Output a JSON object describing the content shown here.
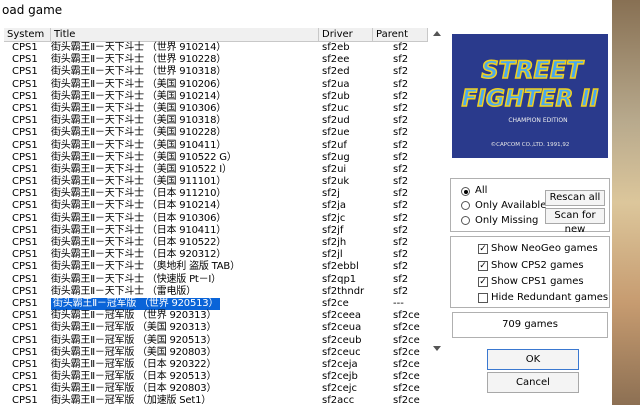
{
  "window": {
    "title": "oad game"
  },
  "list": {
    "columns": {
      "system": "System",
      "title": "Title",
      "driver": "Driver",
      "parent": "Parent"
    },
    "rows": [
      {
        "system": "CPS1",
        "title": "街头霸王Ⅱ－天下斗士 （世界 910214）",
        "driver": "sf2eb",
        "parent": "sf2"
      },
      {
        "system": "CPS1",
        "title": "街头霸王Ⅱ－天下斗士 （世界 910228）",
        "driver": "sf2ee",
        "parent": "sf2"
      },
      {
        "system": "CPS1",
        "title": "街头霸王Ⅱ－天下斗士 （世界 910318）",
        "driver": "sf2ed",
        "parent": "sf2"
      },
      {
        "system": "CPS1",
        "title": "街头霸王Ⅱ－天下斗士 （美国 910206）",
        "driver": "sf2ua",
        "parent": "sf2"
      },
      {
        "system": "CPS1",
        "title": "街头霸王Ⅱ－天下斗士 （美国 910214）",
        "driver": "sf2ub",
        "parent": "sf2"
      },
      {
        "system": "CPS1",
        "title": "街头霸王Ⅱ－天下斗士 （美国 910306）",
        "driver": "sf2uc",
        "parent": "sf2"
      },
      {
        "system": "CPS1",
        "title": "街头霸王Ⅱ－天下斗士 （美国 910318）",
        "driver": "sf2ud",
        "parent": "sf2"
      },
      {
        "system": "CPS1",
        "title": "街头霸王Ⅱ－天下斗士 （美国 910228）",
        "driver": "sf2ue",
        "parent": "sf2"
      },
      {
        "system": "CPS1",
        "title": "街头霸王Ⅱ－天下斗士 （美国 910411）",
        "driver": "sf2uf",
        "parent": "sf2"
      },
      {
        "system": "CPS1",
        "title": "街头霸王Ⅱ－天下斗士 （美国 910522 G）",
        "driver": "sf2ug",
        "parent": "sf2"
      },
      {
        "system": "CPS1",
        "title": "街头霸王Ⅱ－天下斗士 （美国 910522 I）",
        "driver": "sf2ui",
        "parent": "sf2"
      },
      {
        "system": "CPS1",
        "title": "街头霸王Ⅱ－天下斗士 （美国 911101）",
        "driver": "sf2uk",
        "parent": "sf2"
      },
      {
        "system": "CPS1",
        "title": "街头霸王Ⅱ－天下斗士 （日本 911210）",
        "driver": "sf2j",
        "parent": "sf2"
      },
      {
        "system": "CPS1",
        "title": "街头霸王Ⅱ－天下斗士 （日本 910214）",
        "driver": "sf2ja",
        "parent": "sf2"
      },
      {
        "system": "CPS1",
        "title": "街头霸王Ⅱ－天下斗士 （日本 910306）",
        "driver": "sf2jc",
        "parent": "sf2"
      },
      {
        "system": "CPS1",
        "title": "街头霸王Ⅱ－天下斗士 （日本 910411）",
        "driver": "sf2jf",
        "parent": "sf2"
      },
      {
        "system": "CPS1",
        "title": "街头霸王Ⅱ－天下斗士 （日本 910522）",
        "driver": "sf2jh",
        "parent": "sf2"
      },
      {
        "system": "CPS1",
        "title": "街头霸王Ⅱ－天下斗士 （日本 920312）",
        "driver": "sf2jl",
        "parent": "sf2"
      },
      {
        "system": "CPS1",
        "title": "街头霸王Ⅱ－天下斗士 （奥地利 盗版 TAB）",
        "driver": "sf2ebbl",
        "parent": "sf2"
      },
      {
        "system": "CPS1",
        "title": "街头霸王Ⅱ－天下斗士 （快速版 Pt－I）",
        "driver": "sf2qp1",
        "parent": "sf2"
      },
      {
        "system": "CPS1",
        "title": "街头霸王Ⅱ－天下斗士 （雷电版）",
        "driver": "sf2thndr",
        "parent": "sf2"
      },
      {
        "system": "CPS1",
        "title": "街头霸王Ⅱ－冠军版 （世界 920513）",
        "driver": "sf2ce",
        "parent": "---",
        "selected": true
      },
      {
        "system": "CPS1",
        "title": "街头霸王Ⅱ－冠军版 （世界 920313）",
        "driver": "sf2ceea",
        "parent": "sf2ce"
      },
      {
        "system": "CPS1",
        "title": "街头霸王Ⅱ－冠军版 （美国 920313）",
        "driver": "sf2ceua",
        "parent": "sf2ce"
      },
      {
        "system": "CPS1",
        "title": "街头霸王Ⅱ－冠军版 （美国 920513）",
        "driver": "sf2ceub",
        "parent": "sf2ce"
      },
      {
        "system": "CPS1",
        "title": "街头霸王Ⅱ－冠军版 （美国 920803）",
        "driver": "sf2ceuc",
        "parent": "sf2ce"
      },
      {
        "system": "CPS1",
        "title": "街头霸王Ⅱ－冠军版 （日本 920322）",
        "driver": "sf2ceja",
        "parent": "sf2ce"
      },
      {
        "system": "CPS1",
        "title": "街头霸王Ⅱ－冠军版 （日本 920513）",
        "driver": "sf2cejb",
        "parent": "sf2ce"
      },
      {
        "system": "CPS1",
        "title": "街头霸王Ⅱ－冠军版 （日本 920803）",
        "driver": "sf2cejc",
        "parent": "sf2ce"
      },
      {
        "system": "CPS1",
        "title": "街头霸王Ⅱ－冠军版 （加速版 Set1）",
        "driver": "sf2acc",
        "parent": "sf2ce"
      }
    ]
  },
  "preview": {
    "logo_top": "STREET",
    "logo_bottom": "FIGHTER II",
    "edition": "CHAMPION EDITION",
    "copyright": "©CAPCOM CO.,LTD. 1991,92"
  },
  "filter": {
    "all_label": "All",
    "available_label": "Only Available",
    "missing_label": "Only Missing",
    "selected": "all"
  },
  "buttons": {
    "rescan": "Rescan all",
    "scan_new": "Scan for new",
    "ok": "OK",
    "cancel": "Cancel"
  },
  "options": {
    "neogeo": {
      "label": "Show NeoGeo games",
      "checked": true
    },
    "cps2": {
      "label": "Show CPS2 games",
      "checked": true
    },
    "cps1": {
      "label": "Show CPS1 games",
      "checked": true
    },
    "redundant": {
      "label": "Hide Redundant games",
      "checked": false
    }
  },
  "status": {
    "count": "709 games"
  },
  "colors": {
    "selection": "#0a64d8",
    "logo_blue": "#2a3a8c"
  }
}
